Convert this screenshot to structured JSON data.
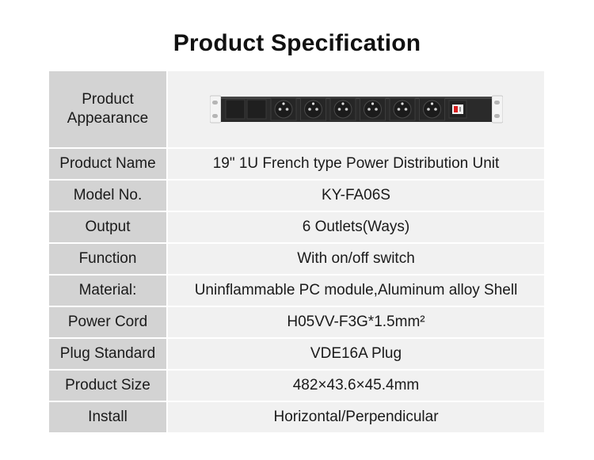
{
  "title": "Product Specification",
  "appearance": {
    "label_line1": "Product",
    "label_line2": "Appearance",
    "image_icon": "power-distribution-unit-image",
    "outlet_count": 6
  },
  "rows": [
    {
      "label": "Product Name",
      "value": "19\" 1U  French type Power Distribution Unit"
    },
    {
      "label": "Model No.",
      "value": "KY-FA06S"
    },
    {
      "label": "Output",
      "value": "6 Outlets(Ways)"
    },
    {
      "label": "Function",
      "value": "With on/off switch"
    },
    {
      "label": "Material:",
      "value": "Uninflammable PC module,Aluminum alloy Shell"
    },
    {
      "label": "Power Cord",
      "value": "H05VV-F3G*1.5mm²"
    },
    {
      "label": "Plug Standard",
      "value": "VDE16A Plug"
    },
    {
      "label": "Product Size",
      "value": "482×43.6×45.4mm"
    },
    {
      "label": "Install",
      "value": "Horizontal/Perpendicular"
    }
  ],
  "colors": {
    "label_bg": "#d3d3d3",
    "value_bg": "#f1f1f1",
    "pdu_body": "#2a2a2a",
    "switch_red": "#d81e1e"
  }
}
